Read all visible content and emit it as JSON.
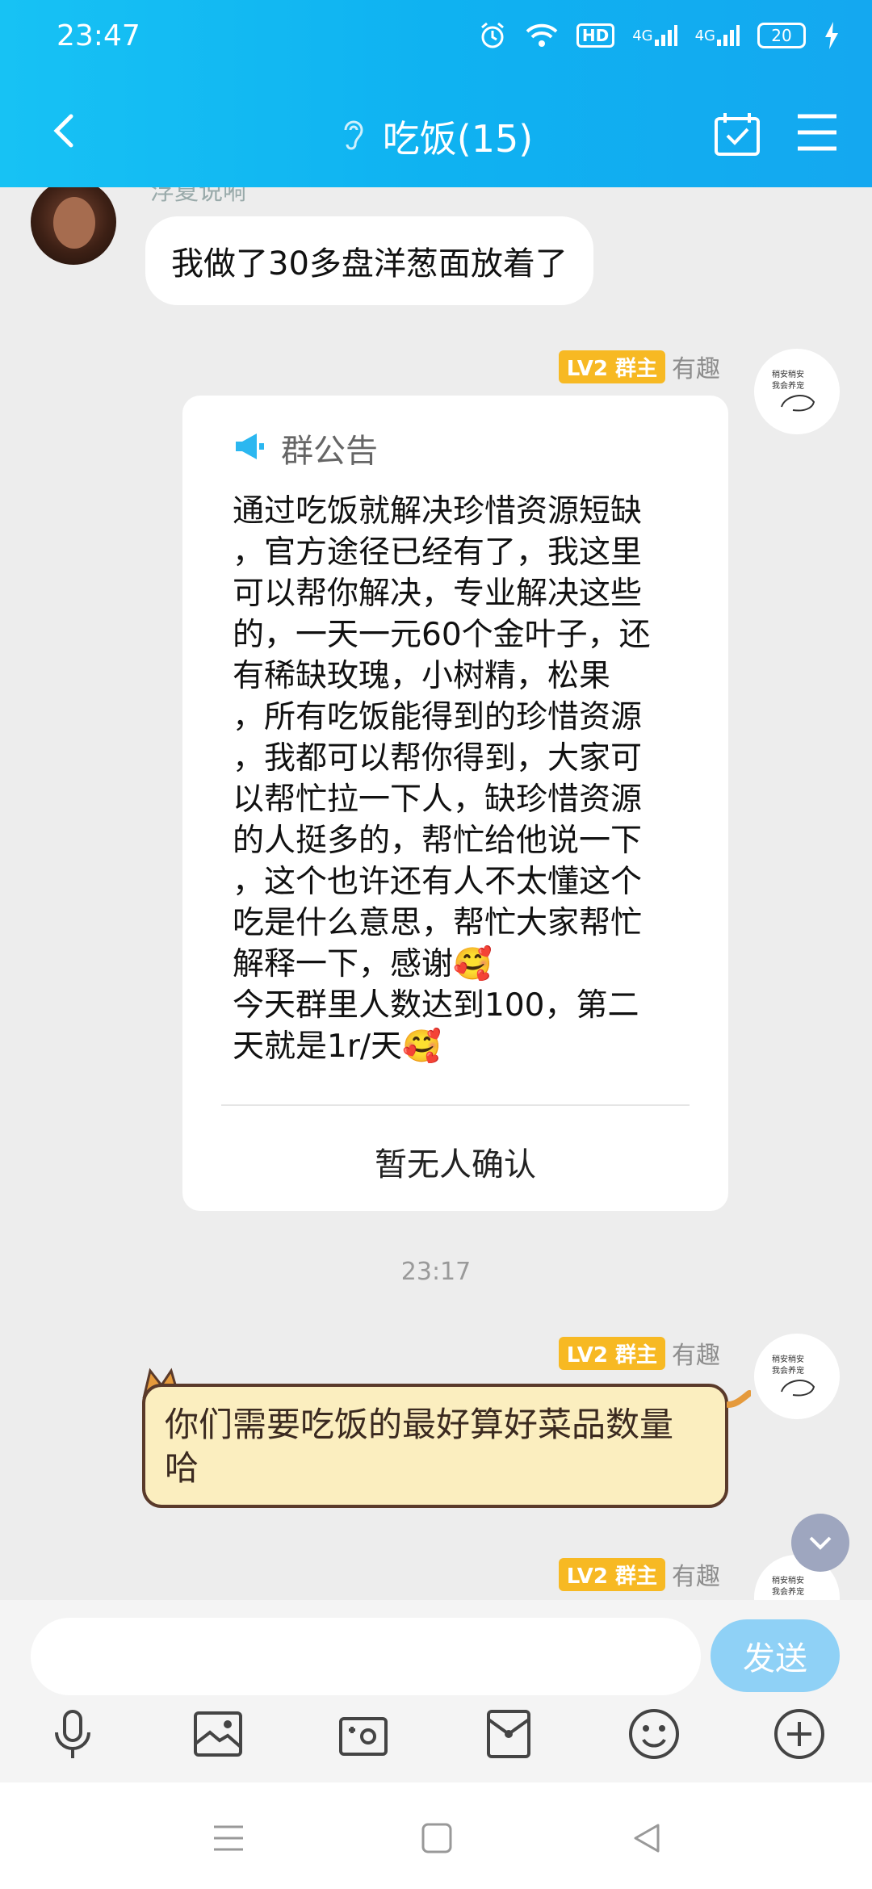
{
  "status": {
    "time": "23:47",
    "battery": "20",
    "hd": "HD",
    "net1": "4G",
    "net2": "4G"
  },
  "header": {
    "title": "吃饭(15)"
  },
  "messages": {
    "first": {
      "sender": "浮夏说嗬",
      "text": "我做了30多盘洋葱面放着了"
    },
    "notice": {
      "badge": "LV2 群主",
      "sender": "有趣",
      "head_label": "群公告",
      "body": "通过吃饭就解决珍惜资源短缺\n，官方途径已经有了，我这里\n可以帮你解决，专业解决这些\n的，一天一元60个金叶子，还\n有稀缺玫瑰，小树精，松果\n，所有吃饭能得到的珍惜资源\n，我都可以帮你得到，大家可\n以帮忙拉一下人，缺珍惜资源\n的人挺多的，帮忙给他说一下\n，这个也许还有人不太懂这个\n吃是什么意思，帮忙大家帮忙\n解释一下，感谢🥰\n今天群里人数达到100，第二\n天就是1r/天🥰",
      "footer": "暂无人确认"
    },
    "timestamp": "23:17",
    "second": {
      "badge": "LV2 群主",
      "sender": "有趣",
      "text": "你们需要吃饭的最好算好菜品数量哈"
    },
    "third": {
      "badge": "LV2 群主",
      "sender": "有趣"
    },
    "avatar_text": "稍安稍安\n我会养宠"
  },
  "input": {
    "placeholder": "",
    "send_label": "发送"
  },
  "tools": [
    "microphone-icon",
    "image-icon",
    "camera-icon",
    "red-packet-icon",
    "emoji-icon",
    "plus-icon"
  ]
}
